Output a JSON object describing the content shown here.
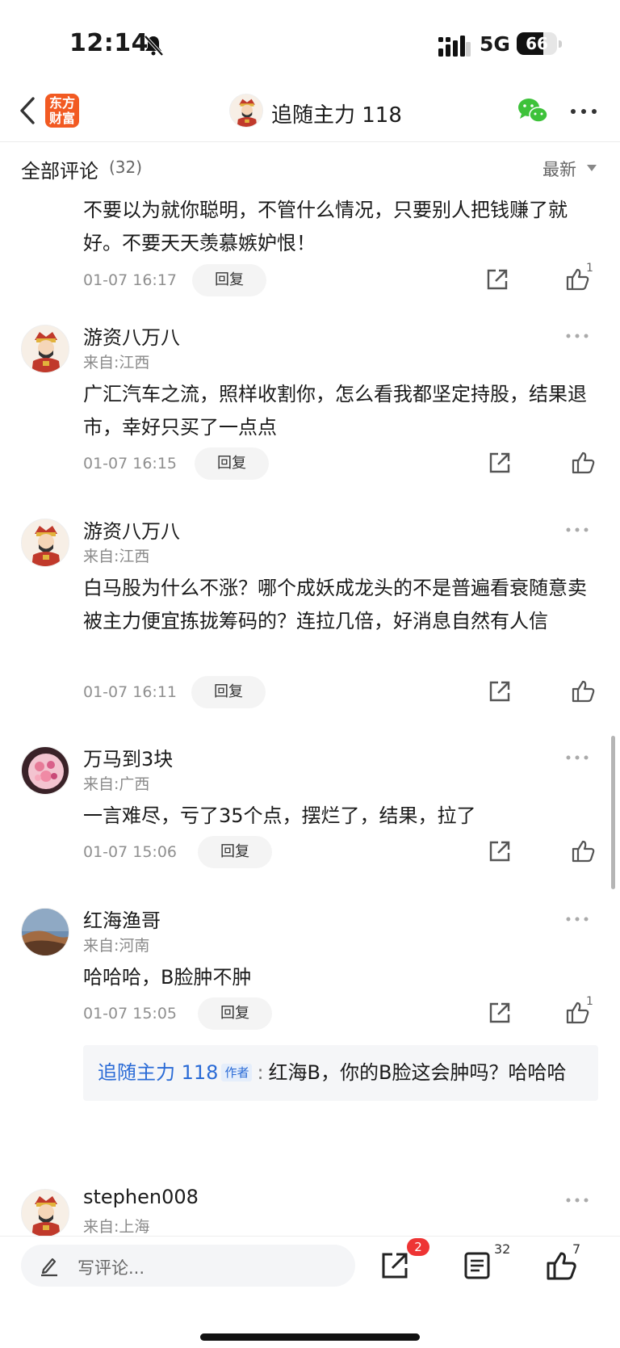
{
  "status_bar": {
    "time": "12:14",
    "network": "5G",
    "battery_percent": 66,
    "battery_label": "66"
  },
  "nav": {
    "title": "追随主力 118",
    "logo_line1": "东方",
    "logo_line2": "财富"
  },
  "comments_header": {
    "title": "全部评论",
    "count": "(32)",
    "sort": "最新"
  },
  "comments": [
    {
      "text": "不要以为就你聪明，不管什么情况，只要别人把钱赚了就好。不要天天羡慕嫉妒恨！",
      "time": "01-07 16:17",
      "reply_label": "回复",
      "likes": "1"
    },
    {
      "user": "游资八万八",
      "location": "来自:江西",
      "text": "广汇汽车之流，照样收割你，怎么看我都坚定持股，结果退市，幸好只买了一点点",
      "time": "01-07 16:15",
      "reply_label": "回复"
    },
    {
      "user": "游资八万八",
      "location": "来自:江西",
      "text": "白马股为什么不涨？哪个成妖成龙头的不是普遍看衰随意卖被主力便宜拣拢筹码的？连拉几倍，好消息自然有人信",
      "time": "01-07 16:11",
      "reply_label": "回复"
    },
    {
      "user": "万马到3块",
      "location": "来自:广西",
      "text": "一言难尽，亏了35个点，摆烂了，结果，拉了",
      "time": "01-07 15:06",
      "reply_label": "回复"
    },
    {
      "user": "红海渔哥",
      "location": "来自:河南",
      "text": "哈哈哈，B脸肿不肿",
      "time": "01-07 15:05",
      "reply_label": "回复",
      "likes": "1",
      "author_reply": {
        "author": "追随主力 118",
        "badge": "作者",
        "colon": ":",
        "text": "红海B，你的B脸这会肿吗？哈哈哈"
      }
    },
    {
      "user": "stephen008",
      "location": "来自:上海"
    }
  ],
  "bottom_bar": {
    "placeholder": "写评论...",
    "share_badge": "2",
    "comment_count": "32",
    "like_count": "7"
  }
}
